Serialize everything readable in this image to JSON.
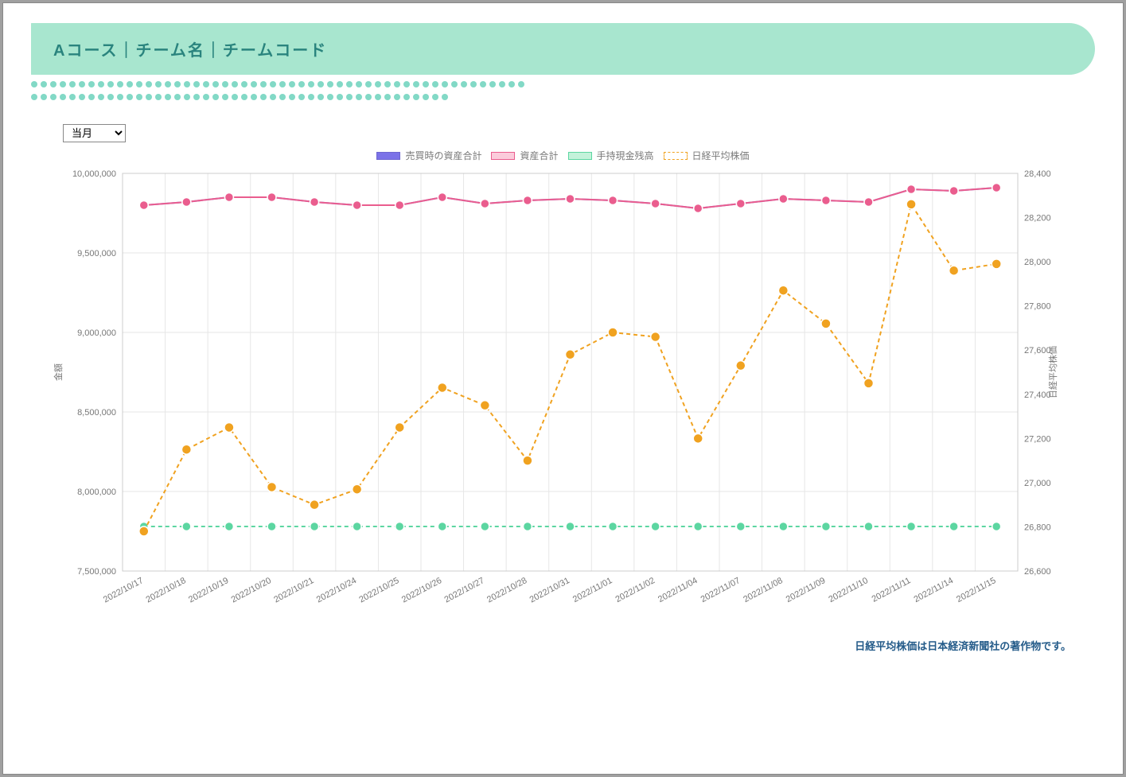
{
  "header": {
    "title": "Aコース｜チーム名｜チームコード"
  },
  "controls": {
    "period_selected": "当月"
  },
  "legend": {
    "series1": "売買時の資産合計",
    "series2": "資産合計",
    "series3": "手持現金残高",
    "series4": "日経平均株価"
  },
  "axes": {
    "left_label": "金額",
    "right_label": "日経平均株価",
    "left_ticks": [
      "7,500,000",
      "8,000,000",
      "8,500,000",
      "9,000,000",
      "9,500,000",
      "10,000,000"
    ],
    "right_ticks": [
      "26,600",
      "26,800",
      "27,000",
      "27,200",
      "27,400",
      "27,600",
      "27,800",
      "28,000",
      "28,200",
      "28,400"
    ]
  },
  "footer": {
    "note": "日経平均株価は日本経済新聞社の著作物です。"
  },
  "colors": {
    "series1_fill": "#7b72e8",
    "series2_fill": "#ea5d8e",
    "series3_fill": "#5cd6a1",
    "series4_fill": "#f0a220"
  },
  "chart_data": {
    "type": "line",
    "categories": [
      "2022/10/17",
      "2022/10/18",
      "2022/10/19",
      "2022/10/20",
      "2022/10/21",
      "2022/10/24",
      "2022/10/25",
      "2022/10/26",
      "2022/10/27",
      "2022/10/28",
      "2022/10/31",
      "2022/11/01",
      "2022/11/02",
      "2022/11/04",
      "2022/11/07",
      "2022/11/08",
      "2022/11/09",
      "2022/11/10",
      "2022/11/11",
      "2022/11/14",
      "2022/11/15"
    ],
    "left_axis": {
      "label": "金額",
      "min": 7500000,
      "max": 10000000
    },
    "right_axis": {
      "label": "日経平均株価",
      "min": 26600,
      "max": 28400
    },
    "series": [
      {
        "name": "売買時の資産合計",
        "axis": "left",
        "style": "solid",
        "color": "#7b72e8",
        "values": [
          9800000,
          9820000,
          9850000,
          9850000,
          9820000,
          9800000,
          9800000,
          9850000,
          9810000,
          9830000,
          9840000,
          9830000,
          9810000,
          9780000,
          9810000,
          9840000,
          9830000,
          9820000,
          9900000,
          9890000,
          9910000
        ]
      },
      {
        "name": "資産合計",
        "axis": "left",
        "style": "solid",
        "color": "#ea5d8e",
        "values": [
          9800000,
          9820000,
          9850000,
          9850000,
          9820000,
          9800000,
          9800000,
          9850000,
          9810000,
          9830000,
          9840000,
          9830000,
          9810000,
          9780000,
          9810000,
          9840000,
          9830000,
          9820000,
          9900000,
          9890000,
          9910000
        ]
      },
      {
        "name": "手持現金残高",
        "axis": "left",
        "style": "dashed",
        "color": "#5cd6a1",
        "values": [
          7780000,
          7780000,
          7780000,
          7780000,
          7780000,
          7780000,
          7780000,
          7780000,
          7780000,
          7780000,
          7780000,
          7780000,
          7780000,
          7780000,
          7780000,
          7780000,
          7780000,
          7780000,
          7780000,
          7780000,
          7780000
        ]
      },
      {
        "name": "日経平均株価",
        "axis": "right",
        "style": "dashed",
        "color": "#f0a220",
        "values": [
          26780,
          27150,
          27250,
          26980,
          26900,
          26970,
          27250,
          27430,
          27350,
          27100,
          27580,
          27680,
          27660,
          27200,
          27530,
          27870,
          27720,
          27450,
          28260,
          27960,
          27990
        ]
      }
    ]
  }
}
